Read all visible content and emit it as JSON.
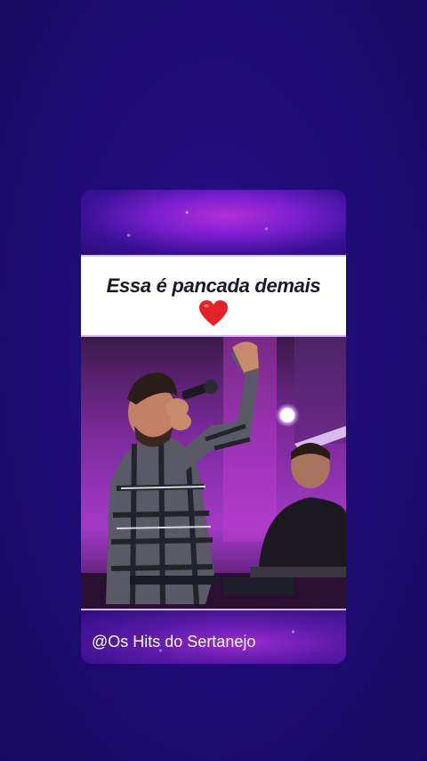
{
  "caption": {
    "text": "Essa é pancada demais",
    "emoji": "heart-emoji"
  },
  "video": {
    "description_icon": "concert-singer-photo"
  },
  "watermark": {
    "handle": "@Os Hits do Sertanejo"
  },
  "colors": {
    "background": "#1f0a6e",
    "caption_background": "#ffffff",
    "heart": "#e8202a",
    "accent_border": "#d6b6ff"
  }
}
